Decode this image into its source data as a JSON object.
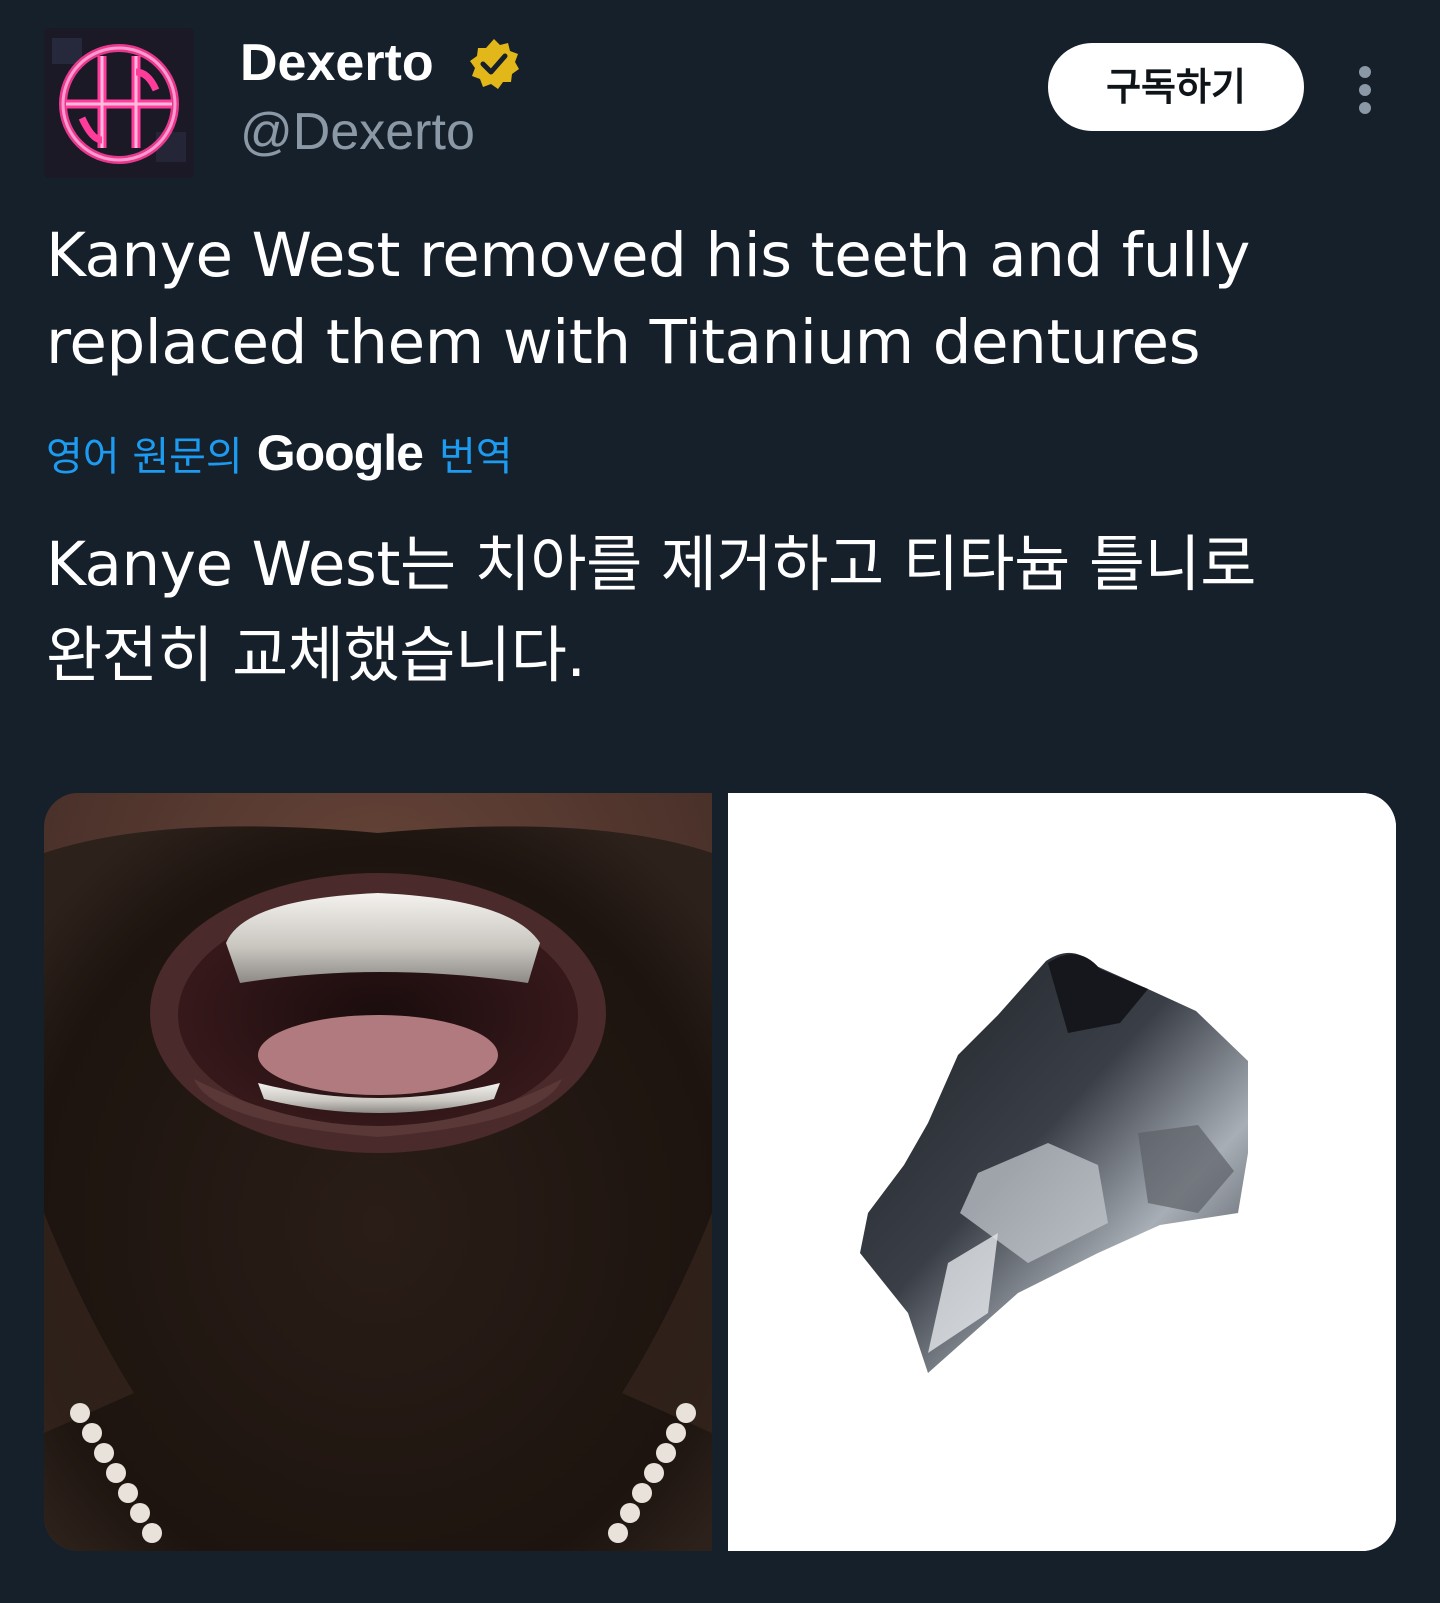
{
  "tweet": {
    "author": {
      "display_name": "Dexerto",
      "handle": "@Dexerto",
      "avatar_icon": "dexerto-logo-icon",
      "verified_icon": "verified-badge-icon",
      "verified_color": "#e2b719"
    },
    "subscribe_label": "구독하기",
    "more_icon": "more-vertical-icon",
    "text_lines": [
      "Kanye West removed his teeth and fully",
      "replaced them with Titanium dentures"
    ],
    "translation": {
      "prefix": "영어 원문의",
      "brand": "Google",
      "suffix": "번역"
    },
    "translated_lines": [
      "Kanye West는 치아를 제거하고 티타늄 틀니로",
      "완전히 교체했습니다."
    ],
    "media": [
      {
        "icon": "mouth-titanium-teeth-photo"
      },
      {
        "icon": "titanium-denture-photo"
      }
    ]
  },
  "colors": {
    "background": "#15202b",
    "text": "#ffffff",
    "secondary_text": "#8b98a5",
    "link": "#1d9bf0",
    "button_bg": "#ffffff",
    "button_text": "#0f1419"
  }
}
